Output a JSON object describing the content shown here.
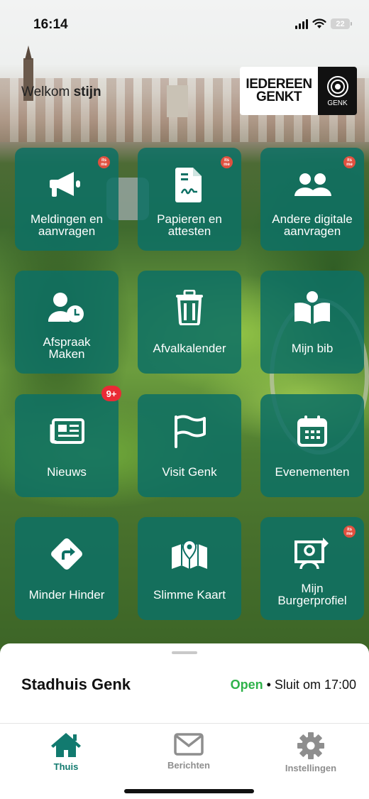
{
  "status_bar": {
    "time": "16:14",
    "battery": "22"
  },
  "header": {
    "welcome_prefix": "Welkom",
    "user_name": "stijn"
  },
  "logo": {
    "line1": "IEDEREEN",
    "line2": "GENKT",
    "badge_text": "GENK"
  },
  "badge_label": "its me",
  "tiles": [
    {
      "label_line1": "Meldingen en",
      "label_line2": "aanvragen",
      "icon": "megaphone-icon",
      "itsme": true
    },
    {
      "label_line1": "Papieren en",
      "label_line2": "attesten",
      "icon": "document-icon",
      "itsme": true
    },
    {
      "label_line1": "Andere digitale",
      "label_line2": "aanvragen",
      "icon": "users-icon",
      "itsme": true
    },
    {
      "label_line1": "Afspraak",
      "label_line2": "Maken",
      "icon": "appointment-icon",
      "itsme": false
    },
    {
      "label_line1": "Afvalkalender",
      "icon": "trash-icon",
      "itsme": false
    },
    {
      "label_line1": "Mijn bib",
      "icon": "reader-icon",
      "itsme": false
    },
    {
      "label_line1": "Nieuws",
      "icon": "newspaper-icon",
      "itsme": false,
      "badge": "9+"
    },
    {
      "label_line1": "Visit Genk",
      "icon": "flag-icon",
      "itsme": false
    },
    {
      "label_line1": "Evenementen",
      "icon": "calendar-icon",
      "itsme": false
    },
    {
      "label_line1": "Minder Hinder",
      "icon": "detour-sign-icon",
      "itsme": false
    },
    {
      "label_line1": "Slimme Kaart",
      "icon": "map-icon",
      "itsme": false
    },
    {
      "label_line1": "Mijn",
      "label_line2": "Burgerprofiel",
      "icon": "profile-icon",
      "itsme": true
    }
  ],
  "location": {
    "name": "Stadhuis Genk",
    "status": "Open",
    "separator": " • ",
    "hours": "Sluit om 17:00"
  },
  "bottom_nav": [
    {
      "label": "Thuis",
      "icon": "home-icon",
      "active": true
    },
    {
      "label": "Berichten",
      "icon": "mail-icon",
      "active": false
    },
    {
      "label": "Instellingen",
      "icon": "gear-icon",
      "active": false
    }
  ],
  "colors": {
    "tile": "#0d7064",
    "accent": "#127a6f",
    "open": "#2eb24a",
    "badge": "#ea2a35",
    "itsme": "#e0503f"
  }
}
